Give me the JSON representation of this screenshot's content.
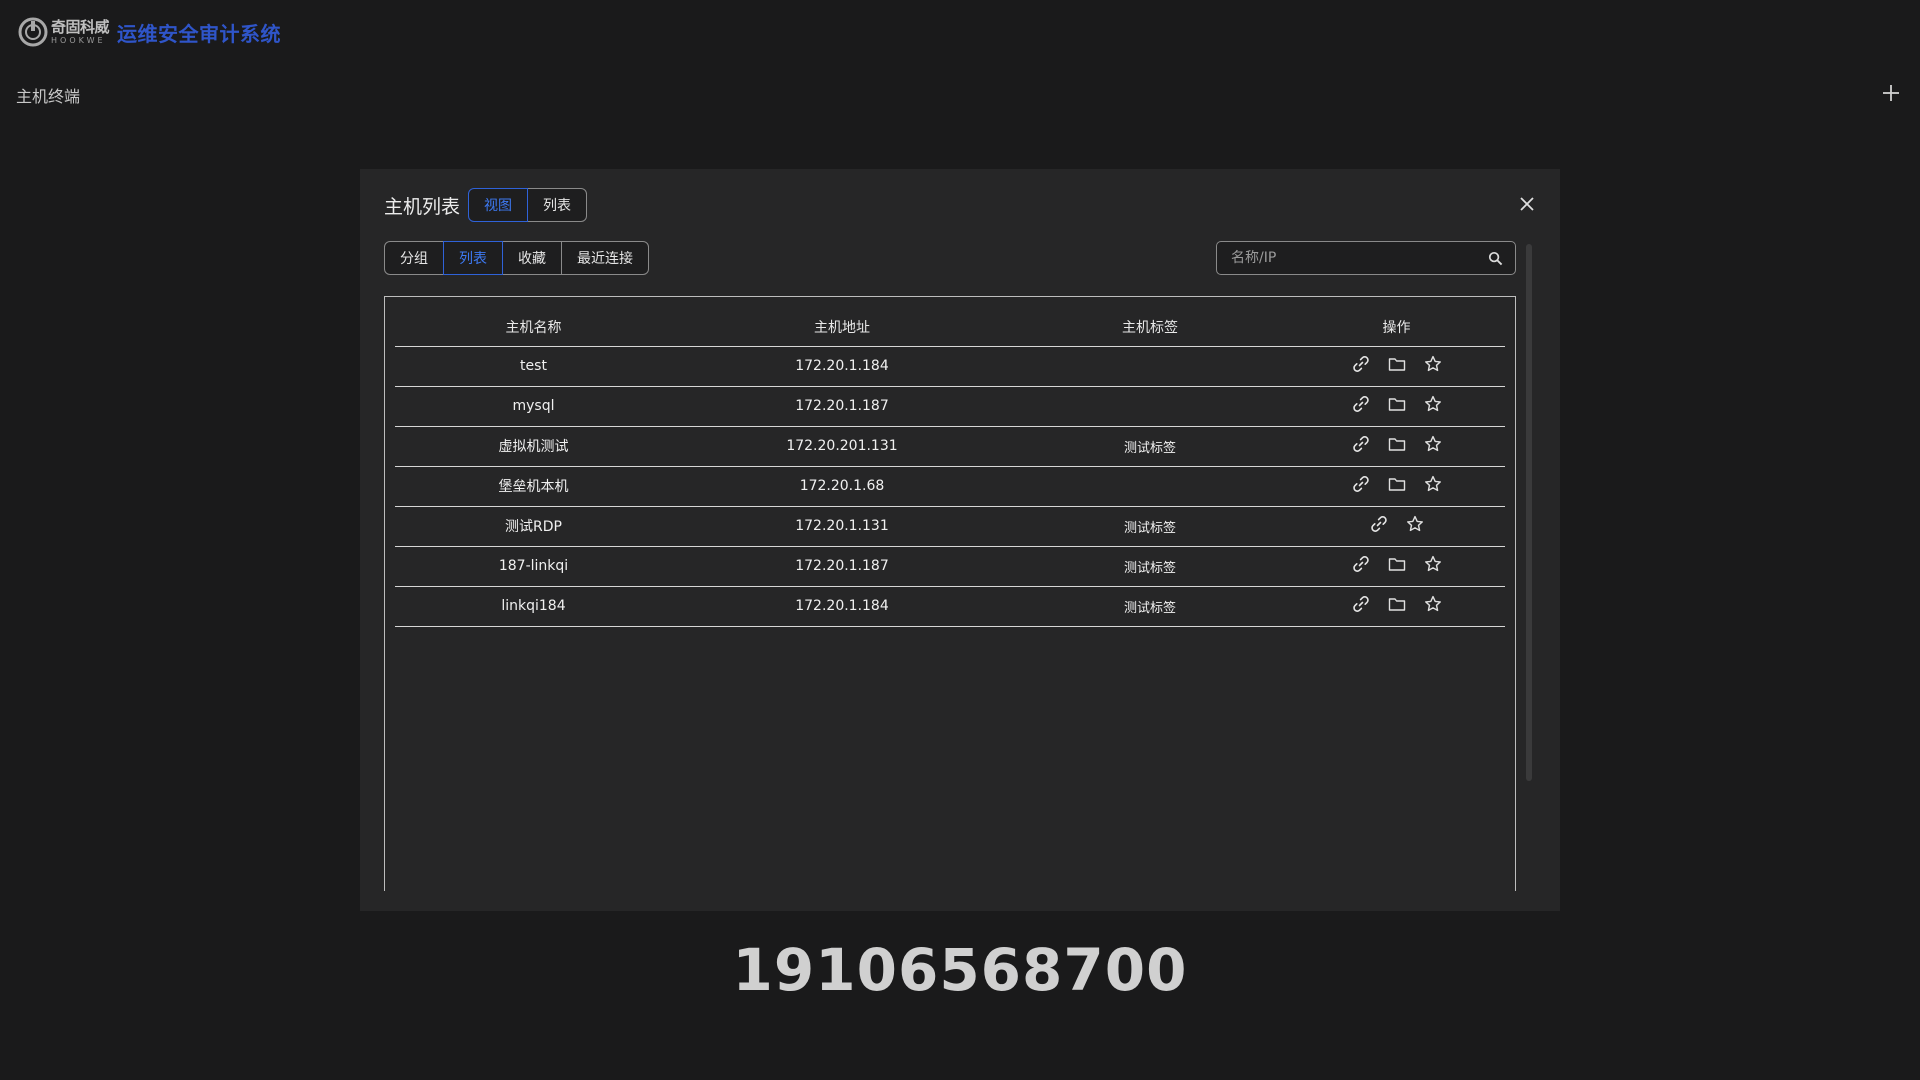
{
  "header": {
    "logo_cn": "奇固科威",
    "logo_en": "HOOKWE",
    "app_title": "运维安全审计系统"
  },
  "page": {
    "section_title": "主机终端",
    "add_icon": "plus-icon"
  },
  "modal": {
    "title": "主机列表",
    "view_tabs": [
      {
        "label": "视图",
        "active": true
      },
      {
        "label": "列表",
        "active": false
      }
    ],
    "filter_tabs": [
      {
        "label": "分组",
        "active": false
      },
      {
        "label": "列表",
        "active": true
      },
      {
        "label": "收藏",
        "active": false
      },
      {
        "label": "最近连接",
        "active": false
      }
    ],
    "search": {
      "placeholder": "名称/IP",
      "value": ""
    },
    "table": {
      "columns": [
        "主机名称",
        "主机地址",
        "主机标签",
        "操作"
      ],
      "rows": [
        {
          "name": "test",
          "address": "172.20.1.184",
          "tag": "",
          "actions": [
            "link-icon",
            "folder-icon",
            "star-icon"
          ]
        },
        {
          "name": "mysql",
          "address": "172.20.1.187",
          "tag": "",
          "actions": [
            "link-icon",
            "folder-icon",
            "star-icon"
          ]
        },
        {
          "name": "虚拟机测试",
          "address": "172.20.201.131",
          "tag": "测试标签",
          "actions": [
            "link-icon",
            "folder-icon",
            "star-icon"
          ]
        },
        {
          "name": "堡垒机本机",
          "address": "172.20.1.68",
          "tag": "",
          "actions": [
            "link-icon",
            "folder-icon",
            "star-icon"
          ]
        },
        {
          "name": "测试RDP",
          "address": "172.20.1.131",
          "tag": "测试标签",
          "actions": [
            "link-icon",
            "star-icon"
          ]
        },
        {
          "name": "187-linkqi",
          "address": "172.20.1.187",
          "tag": "测试标签",
          "actions": [
            "link-icon",
            "folder-icon",
            "star-icon"
          ]
        },
        {
          "name": "linkqi184",
          "address": "172.20.1.184",
          "tag": "测试标签",
          "actions": [
            "link-icon",
            "folder-icon",
            "star-icon"
          ]
        }
      ]
    }
  },
  "footer": {
    "watermark_number": "19106568700"
  },
  "colors": {
    "background": "#1a1a1b",
    "modal_bg": "#262627",
    "accent_blue": "#2f55c9",
    "active_tab": "#3d79f2"
  }
}
